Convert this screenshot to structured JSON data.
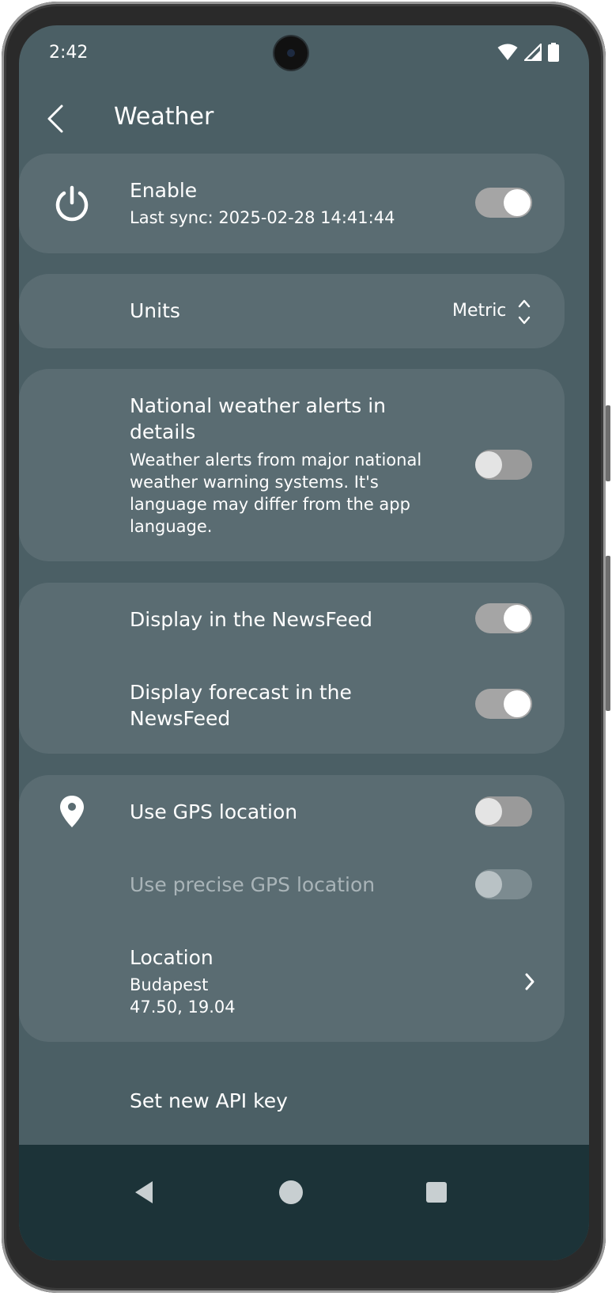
{
  "status_bar": {
    "time": "2:42",
    "icons": [
      "wifi-icon",
      "cellular-signal-icon",
      "battery-icon"
    ]
  },
  "app_bar": {
    "title": "Weather",
    "back_icon": "chevron-left-icon"
  },
  "enable": {
    "title": "Enable",
    "subtitle": "Last sync: 2025-02-28 14:41:44",
    "icon": "power-icon",
    "enabled": true
  },
  "units": {
    "label": "Units",
    "value": "Metric",
    "icon": "unfold-chevron-icon"
  },
  "alerts": {
    "title": "National weather alerts in details",
    "description": "Weather alerts from major national weather warning systems. It's language may differ from the app language.",
    "enabled": false
  },
  "newsfeed": {
    "display_label": "Display in the NewsFeed",
    "display_enabled": true,
    "forecast_label": "Display forecast in the NewsFeed",
    "forecast_enabled": true
  },
  "location": {
    "gps_label": "Use GPS location",
    "gps_enabled": false,
    "gps_icon": "location-pin-icon",
    "precise_label": "Use precise GPS location",
    "precise_enabled": false,
    "precise_disabled": true,
    "location_label": "Location",
    "city": "Budapest",
    "coordinates": "47.50, 19.04"
  },
  "api_key": {
    "label": "Set new API key"
  },
  "nav": {
    "back": "nav-back-icon",
    "home": "nav-home-icon",
    "recents": "nav-recents-icon"
  },
  "colors": {
    "background": "#4b5f65",
    "card": "#5a6c72",
    "nav_bar": "#1c3338",
    "toggle_on_track": "#a5a5a5",
    "toggle_knob": "#ffffff"
  }
}
